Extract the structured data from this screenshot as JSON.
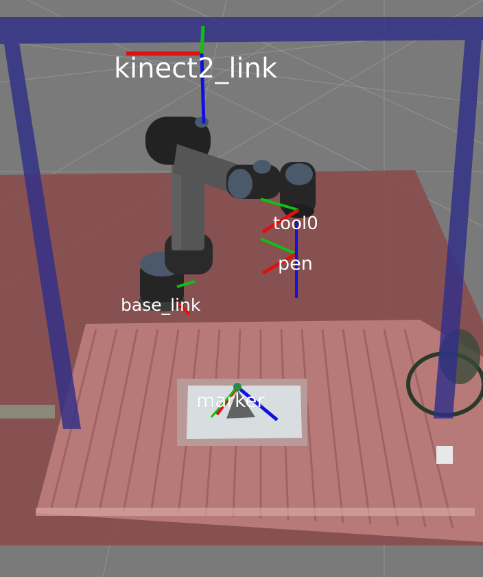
{
  "viewport": {
    "background_color": "#7a7a7a",
    "grid_color": "#9a9a9a",
    "table_plane_color": "#8a4a4a",
    "pointcloud_color": "#b87a78",
    "frame_post_color": "#2e2e8a",
    "paper_color": "#d8dee0"
  },
  "axis_colors": {
    "x": "#e01010",
    "y": "#10c010",
    "z": "#1010e0"
  },
  "frames": [
    {
      "id": "kinect2_link",
      "label": "kinect2_link"
    },
    {
      "id": "tool0",
      "label": "tool0"
    },
    {
      "id": "pen",
      "label": "pen"
    },
    {
      "id": "base_link",
      "label": "base_link"
    },
    {
      "id": "marker",
      "label": "marker"
    }
  ],
  "robot": {
    "model": "ur-arm",
    "body_color": "#2a2a2a",
    "cap_color": "#4a5a6a"
  }
}
